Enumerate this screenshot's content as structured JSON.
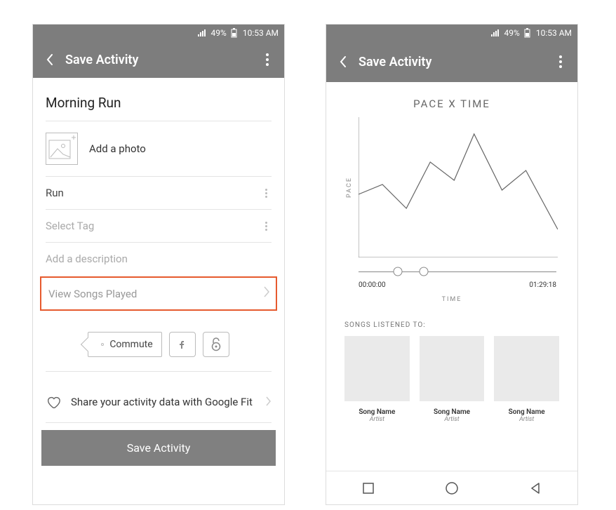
{
  "status": {
    "battery_percent": "49%",
    "time": "10:53 AM"
  },
  "left": {
    "app_title": "Save Activity",
    "activity_title": "Morning Run",
    "add_photo_label": "Add a photo",
    "activity_type": "Run",
    "select_tag_placeholder": "Select Tag",
    "description_placeholder": "Add a description",
    "view_songs_label": "View Songs Played",
    "commute_label": "Commute",
    "share_label": "Share your activity data with Google Fit",
    "save_button": "Save Activity"
  },
  "right": {
    "app_title": "Save Activity",
    "chart_title": "PACE X TIME",
    "ylabel": "PACE",
    "xlabel": "TIME",
    "time_start": "00:00:00",
    "time_end": "01:29:18",
    "songs_header": "SONGS LISTENED TO:",
    "songs": [
      {
        "name": "Song Name",
        "artist": "Artist"
      },
      {
        "name": "Song Name",
        "artist": "Artist"
      },
      {
        "name": "Song Name",
        "artist": "Artist"
      }
    ]
  },
  "chart_data": {
    "type": "line",
    "title": "PACE X TIME",
    "xlabel": "TIME",
    "ylabel": "PACE",
    "x": [
      0,
      12,
      24,
      36,
      48,
      58,
      72,
      84,
      100
    ],
    "y": [
      45,
      52,
      35,
      68,
      55,
      88,
      48,
      62,
      20
    ],
    "xlim": [
      0,
      100
    ],
    "ylim": [
      0,
      100
    ],
    "x_time_range": [
      "00:00:00",
      "01:29:18"
    ]
  }
}
